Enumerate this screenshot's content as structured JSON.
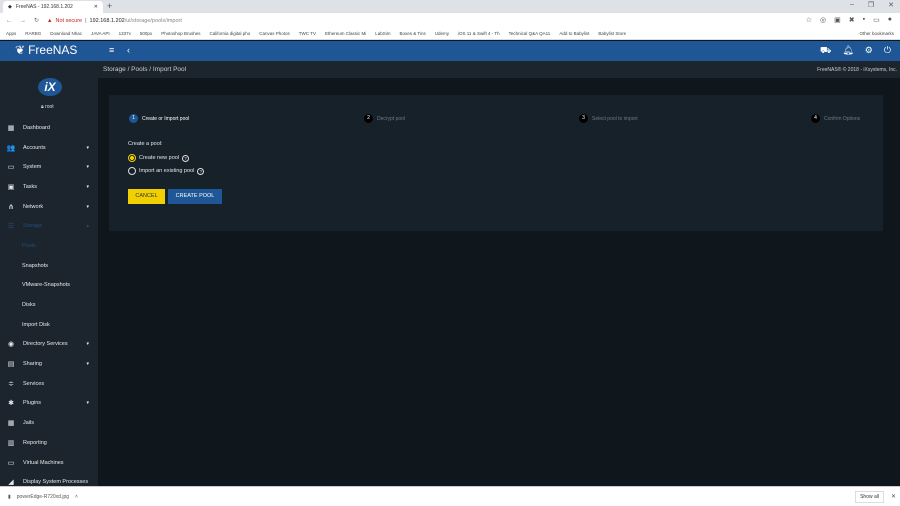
{
  "browser": {
    "tab_title": "FreeNAS - 192.168.1.202",
    "not_secure": "Not secure",
    "url_host": "192.168.1.202",
    "url_path": "/ui/storage/pools/import",
    "bookmarks": [
      "Apps",
      "RARBG",
      "Download Nhac",
      "JAVA API",
      "1337x",
      "500px",
      "Photoshop Brushes",
      "California digital pho",
      "Canvas Photos",
      "TWC TV",
      "Ethereum Classic Mi",
      "LabSim",
      "Boxes & Tins",
      "Udemy",
      "iOS 11 & Swift 4 - Th",
      "Technical Q&A QA11",
      "Add to Babylist",
      "Babylist Store"
    ],
    "other_bookmarks": "Other bookmarks"
  },
  "header": {
    "brand": "FreeNAS"
  },
  "breadcrumb": "Storage / Pools / Import Pool",
  "copyright": "FreeNAS® © 2018 - iXsystems, Inc.",
  "user": {
    "logo": "iX",
    "name": "root"
  },
  "sidebar": [
    {
      "label": "Dashboard",
      "icon": "▦"
    },
    {
      "label": "Accounts",
      "icon": "👥",
      "caret": "▾"
    },
    {
      "label": "System",
      "icon": "▭",
      "caret": "▾"
    },
    {
      "label": "Tasks",
      "icon": "▣",
      "caret": "▾"
    },
    {
      "label": "Network",
      "icon": "⋔",
      "caret": "▾"
    },
    {
      "label": "Storage",
      "icon": "☰",
      "caret": "▴"
    },
    {
      "label": "Pools",
      "sub": true
    },
    {
      "label": "Snapshots",
      "sub": true
    },
    {
      "label": "VMware-Snapshots",
      "sub": true
    },
    {
      "label": "Disks",
      "sub": true
    },
    {
      "label": "Import Disk",
      "sub": true
    },
    {
      "label": "Directory Services",
      "icon": "◉",
      "caret": "▾"
    },
    {
      "label": "Sharing",
      "icon": "▤",
      "caret": "▾"
    },
    {
      "label": "Services",
      "icon": "≑"
    },
    {
      "label": "Plugins",
      "icon": "✱",
      "caret": "▾"
    },
    {
      "label": "Jails",
      "icon": "▦"
    },
    {
      "label": "Reporting",
      "icon": "▥"
    },
    {
      "label": "Virtual Machines",
      "icon": "▭"
    },
    {
      "label": "Display System Processes",
      "icon": "◢"
    }
  ],
  "wizard": {
    "steps": [
      {
        "n": "1",
        "label": "Create or Import pool"
      },
      {
        "n": "2",
        "label": "Decrypt pool"
      },
      {
        "n": "3",
        "label": "Select pool to import"
      },
      {
        "n": "4",
        "label": "Confirm Options"
      }
    ],
    "prompt": "Create a pool:",
    "options": [
      "Create new pool",
      "Import an existing pool"
    ],
    "cancel": "CANCEL",
    "create": "CREATE POOL"
  },
  "download": {
    "file": "powerEdge-R720xd.jpg",
    "show_all": "Show all"
  },
  "colors": {
    "header": "#1f5796",
    "accent": "#f0d000"
  }
}
